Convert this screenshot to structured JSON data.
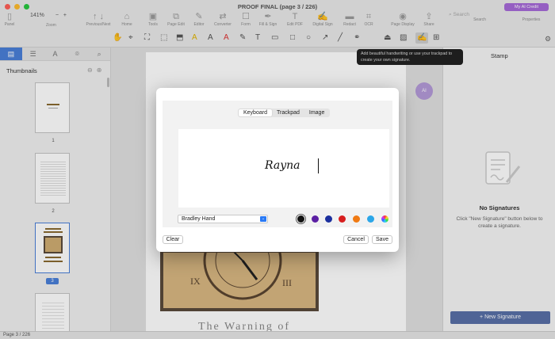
{
  "window": {
    "title": "PROOF FINAL (page 3 / 226)",
    "ai_credit": "My AI Credit"
  },
  "colors": {
    "accent": "#4a7fd8",
    "sidebar_button": "#5870a8",
    "ai_button": "#a66ad8"
  },
  "toolbar": {
    "zoom": "141%",
    "zoom_minus": "−",
    "zoom_plus": "+",
    "labels": {
      "panel": "Panel",
      "zoom": "Zoom",
      "prev_next": "Previous/Next",
      "home": "Home",
      "tools": "Tools",
      "page_edit": "Page Edit",
      "editor": "Editor",
      "converter": "Converter",
      "form": "Form",
      "fill_sign": "Fill & Sign",
      "edit_pdf": "Edit PDF",
      "digital_sign": "Digital Sign",
      "redact": "Redact",
      "ocr": "OCR",
      "page_display": "Page Display",
      "share": "Share",
      "search": "Search",
      "properties": "Properties"
    },
    "search_placeholder": "Search"
  },
  "sidebar": {
    "title": "Thumbnails",
    "pages": [
      {
        "num": "1"
      },
      {
        "num": "2"
      },
      {
        "num": "3"
      }
    ]
  },
  "tooltip": "Add beautiful handwriting or use your trackpad to create your own signature.",
  "right_panel": {
    "tab": "Stamp",
    "empty_title": "No Signatures",
    "empty_desc": "Click \"New Signature\" button below to create a signature.",
    "new_button": "New Signature"
  },
  "status": "Page 3 / 226",
  "modal": {
    "tabs": [
      "Keyboard",
      "Trackpad",
      "Image"
    ],
    "active_tab": "Keyboard",
    "signature_text": "Rayna",
    "font": "Bradley Hand",
    "swatches": [
      "#111111",
      "#5b1fa3",
      "#1b2f9e",
      "#d71e1e",
      "#f07a13",
      "#2ba6e8",
      "conic"
    ],
    "clear": "Clear",
    "cancel": "Cancel",
    "save": "Save"
  },
  "document": {
    "footer_title": "The Warning of"
  }
}
